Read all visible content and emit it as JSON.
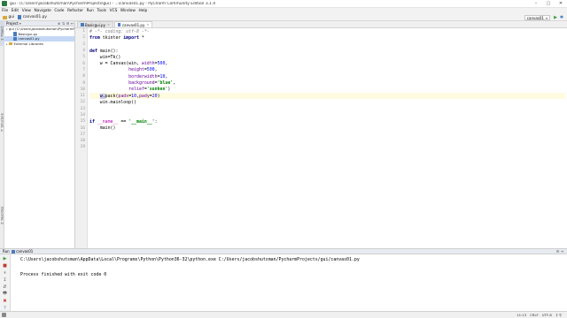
{
  "window": {
    "title": "gui - [C:\\Users\\jacobshutsman\\PycharmProjects\\gui] - ...\\canvas01.py - PyCharm Community Edition 3.1.4",
    "minimize": "–",
    "maximize": "▢",
    "close": "✕"
  },
  "menu": [
    "File",
    "Edit",
    "View",
    "Navigate",
    "Code",
    "Refactor",
    "Run",
    "Tools",
    "VCS",
    "Window",
    "Help"
  ],
  "breadcrumbs": [
    "gui",
    "canvas01.py"
  ],
  "toolbar": {
    "run_config": "canvas01",
    "run_icon": "▶",
    "debug_icon": "✱",
    "more_icon": "▾"
  },
  "side_tabs": {
    "project": "1: Project",
    "structure": "7: Structure",
    "favorites": "2: Favorites"
  },
  "project_panel": {
    "header": "Project",
    "actions": [
      "⊕",
      "⇅",
      "⚙",
      "↤"
    ],
    "tree": [
      {
        "label": "gui  (C:\\Users\\jacobshutsman\\PycharmProjects\\gui)",
        "indent": 0,
        "arrow": "▾",
        "icon": "folder"
      },
      {
        "label": "Basicgui.py",
        "indent": 1,
        "arrow": "",
        "icon": "pyfile"
      },
      {
        "label": "canvas01.py",
        "indent": 1,
        "arrow": "",
        "icon": "pyfile",
        "selected": true
      },
      {
        "label": "External Libraries",
        "indent": 0,
        "arrow": "▸",
        "icon": "folder"
      }
    ]
  },
  "editor": {
    "tabs": [
      {
        "label": "Basicgui.py",
        "active": false,
        "close": "×"
      },
      {
        "label": "canvas01.py",
        "active": true,
        "close": "×"
      }
    ],
    "current_line": 11,
    "lines": [
      {
        "n": "1",
        "tokens": [
          [
            "cm",
            "# -*- coding: utf-8 -*-"
          ]
        ]
      },
      {
        "n": "2",
        "tokens": [
          [
            "kw",
            "from"
          ],
          [
            "",
            " tkinter "
          ],
          [
            "kw",
            "import"
          ],
          [
            "",
            " *"
          ]
        ]
      },
      {
        "n": "3",
        "tokens": []
      },
      {
        "n": "4",
        "tokens": [
          [
            "kw",
            "def"
          ],
          [
            "",
            " main():"
          ]
        ]
      },
      {
        "n": "5",
        "tokens": [
          [
            "",
            "    win=Tk()"
          ]
        ]
      },
      {
        "n": "6",
        "tokens": [
          [
            "",
            "    w = Canvas(win, "
          ],
          [
            "kwarg",
            "width"
          ],
          [
            "",
            "="
          ],
          [
            "num",
            "500"
          ],
          [
            "",
            ","
          ]
        ]
      },
      {
        "n": "7",
        "tokens": [
          [
            "",
            "               "
          ],
          [
            "kwarg",
            "height"
          ],
          [
            "",
            "="
          ],
          [
            "num",
            "500"
          ],
          [
            "",
            ","
          ]
        ]
      },
      {
        "n": "8",
        "tokens": [
          [
            "",
            "               "
          ],
          [
            "kwarg",
            "borderwidth"
          ],
          [
            "",
            "="
          ],
          [
            "num",
            "10"
          ],
          [
            "",
            ","
          ]
        ]
      },
      {
        "n": "9",
        "tokens": [
          [
            "",
            "               "
          ],
          [
            "kwarg",
            "background"
          ],
          [
            "",
            "="
          ],
          [
            "str",
            "'blue'"
          ],
          [
            "",
            ","
          ]
        ]
      },
      {
        "n": "10",
        "tokens": [
          [
            "",
            "               "
          ],
          [
            "kwarg",
            "relief"
          ],
          [
            "",
            "="
          ],
          [
            "str",
            "'sunken'"
          ],
          [
            "",
            ")"
          ]
        ]
      },
      {
        "n": "11",
        "tokens": [
          [
            "",
            "    "
          ],
          [
            "hl",
            "w."
          ],
          [
            "",
            "pack("
          ],
          [
            "kwarg",
            "padx"
          ],
          [
            "",
            "="
          ],
          [
            "num",
            "10"
          ],
          [
            "",
            ","
          ],
          [
            "kwarg",
            "pady"
          ],
          [
            "",
            "="
          ],
          [
            "num",
            "20"
          ],
          [
            "",
            ")"
          ]
        ]
      },
      {
        "n": "12",
        "tokens": [
          [
            "",
            "    win.mainloop()"
          ]
        ]
      },
      {
        "n": "13",
        "tokens": []
      },
      {
        "n": "14",
        "tokens": []
      },
      {
        "n": "15",
        "tokens": [
          [
            "kw",
            "if"
          ],
          [
            "",
            " "
          ],
          [
            "dunder",
            "__name__"
          ],
          [
            "",
            " == "
          ],
          [
            "str",
            "'__main__'"
          ],
          [
            "",
            ":"
          ]
        ]
      },
      {
        "n": "16",
        "tokens": [
          [
            "",
            "    main()"
          ]
        ]
      },
      {
        "n": "17",
        "tokens": []
      },
      {
        "n": "18",
        "tokens": []
      },
      {
        "n": "19",
        "tokens": []
      }
    ]
  },
  "run_panel": {
    "label": "Run",
    "config": "canvas01",
    "settings_icon": "⚙ ⇥",
    "tools": [
      "▶",
      "■",
      "⏸",
      "↧",
      "⇵",
      "🖶",
      "✖",
      "?"
    ],
    "output": [
      "C:\\Users\\jacobshutsman\\AppData\\Local\\Programs\\Python\\Python36-32\\python.exe C:/Users/jacobshutsman/PycharmProjects/gui/canvas01.py",
      "",
      "Process finished with exit code 0"
    ]
  },
  "status": {
    "position": "11:13",
    "line_sep": "CRLF",
    "encoding": "UTF-8",
    "extra": "↕ ⚲"
  },
  "colors": {
    "keyword": "#000080",
    "string": "#008000",
    "number": "#0000ff",
    "comment": "#808080",
    "kwarg": "#660099"
  }
}
